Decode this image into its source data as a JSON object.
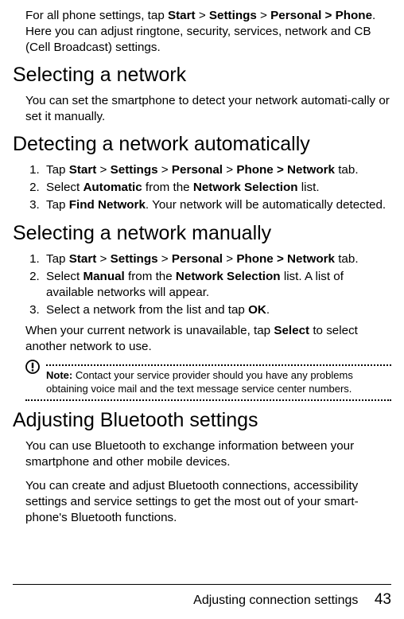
{
  "intro": {
    "p1_a": "For all phone settings, tap ",
    "p1_b": ". Here you can adjust ringtone, security, services, network and CB (Cell Broadcast) settings.",
    "path1_start": "Start",
    "path1_settings": "Settings",
    "path1_personal_phone": "Personal > Phone",
    "gt": " > "
  },
  "sec1": {
    "title": "Selecting a network",
    "p": "You can set the smartphone to detect your network automati-cally or set it manually."
  },
  "sec2": {
    "title": "Detecting a network automatically",
    "li1_a": "Tap ",
    "li1_start": "Start",
    "li1_settings": "Settings",
    "li1_personal": "Personal",
    "li1_phone_net": "Phone > Network",
    "li1_b": " tab.",
    "li2_a": "Select ",
    "li2_auto": "Automatic",
    "li2_b": " from the ",
    "li2_ns": "Network Selection",
    "li2_c": " list.",
    "li3_a": "Tap ",
    "li3_fn": "Find Network",
    "li3_b": ". Your network will be automatically detected."
  },
  "sec3": {
    "title": "Selecting a network manually",
    "li1_a": "Tap ",
    "li1_start": "Start",
    "li1_settings": "Settings",
    "li1_personal": "Personal",
    "li1_phone_net": "Phone > Network",
    "li1_b": " tab.",
    "li2_a": "Select ",
    "li2_manual": "Manual",
    "li2_b": " from the ",
    "li2_ns": "Network Selection",
    "li2_c": " list. A list of available networks will appear.",
    "li3_a": "Select a network from the list and tap ",
    "li3_ok": "OK",
    "li3_b": ".",
    "p_a": "When your current network is unavailable, tap ",
    "p_sel": "Select",
    "p_b": " to select another network to use."
  },
  "note": {
    "label": "Note:",
    "text": " Contact your service provider should you have any problems obtaining voice mail and the text message service center numbers."
  },
  "sec4": {
    "title": "Adjusting Bluetooth settings",
    "p1": "You can use Bluetooth to exchange information between your smartphone and other mobile devices.",
    "p2": "You can create and adjust Bluetooth connections, accessibility settings and service settings to get the most out of your smart-phone's Bluetooth functions."
  },
  "footer": {
    "title": "Adjusting connection settings",
    "page": "43"
  }
}
